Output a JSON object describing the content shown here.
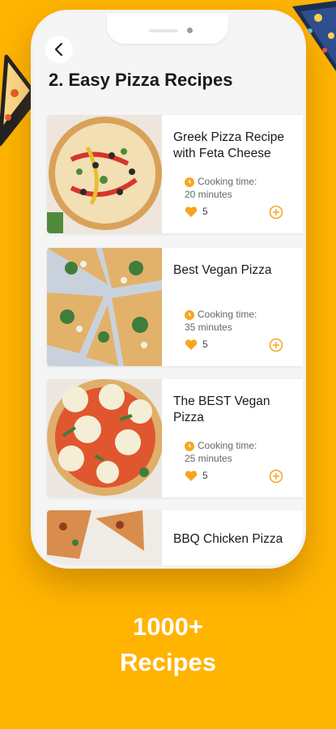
{
  "app": {
    "page_title": "2. Easy Pizza Recipes",
    "back_icon": "chevron-left-icon"
  },
  "recipes": [
    {
      "title": "Greek Pizza Recipe\nwith Feta Cheese",
      "cooking_time_label": "Cooking time:",
      "cooking_time_value": "20 minutes",
      "likes": "5"
    },
    {
      "title": "Best Vegan Pizza",
      "cooking_time_label": "Cooking time:",
      "cooking_time_value": "35 minutes",
      "likes": "5"
    },
    {
      "title": "The BEST Vegan\nPizza",
      "cooking_time_label": "Cooking time:",
      "cooking_time_value": "25 minutes",
      "likes": "5"
    },
    {
      "title": "BBQ Chicken Pizza"
    }
  ],
  "promo": {
    "line1": "1000+",
    "line2": "Recipes"
  },
  "colors": {
    "background": "#FFB400",
    "accent": "#F7A521",
    "text": "#1a1a1a"
  }
}
